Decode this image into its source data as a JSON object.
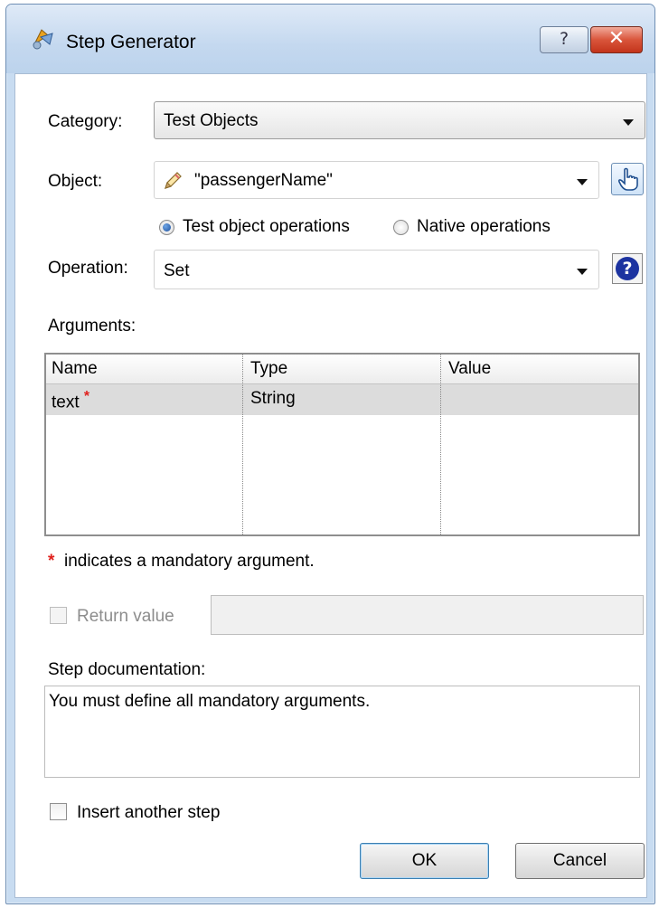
{
  "window": {
    "title": "Step Generator",
    "help_glyph": "?",
    "close_glyph": "✕"
  },
  "category": {
    "label": "Category:",
    "value": "Test Objects"
  },
  "object": {
    "label": "Object:",
    "value": "\"passengerName\"",
    "icon": "pencil-icon",
    "picker_icon": "pointing-hand-icon"
  },
  "operation_type": {
    "options": [
      {
        "label": "Test object operations",
        "selected": true
      },
      {
        "label": "Native operations",
        "selected": false
      }
    ]
  },
  "operation": {
    "label": "Operation:",
    "value": "Set",
    "help_glyph": "?"
  },
  "arguments": {
    "label": "Arguments:",
    "columns": [
      "Name",
      "Type",
      "Value"
    ],
    "rows": [
      {
        "name": "text",
        "mandatory_mark": "*",
        "type": "String",
        "value": ""
      }
    ],
    "note_mark": "*",
    "note": "indicates a mandatory argument."
  },
  "return_value": {
    "label": "Return value",
    "checked": false,
    "enabled": false,
    "value": ""
  },
  "step_documentation": {
    "label": "Step documentation:",
    "text": "You must define all mandatory arguments."
  },
  "insert_another": {
    "label": "Insert another step",
    "checked": false
  },
  "buttons": {
    "ok": "OK",
    "cancel": "Cancel"
  },
  "colors": {
    "accent": "#1c4f9c",
    "mandatory": "#e0201c",
    "titlebar": "#c4d8ef"
  }
}
